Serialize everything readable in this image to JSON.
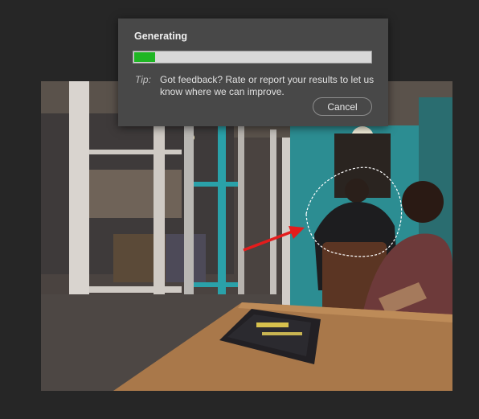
{
  "dialog": {
    "title": "Generating",
    "progress_fraction": 0.09,
    "progress_color": "#1fb624",
    "tip_label": "Tip:",
    "tip_text": "Got feedback? Rate or report your results to let us know where we can improve.",
    "cancel_label": "Cancel"
  },
  "canvas": {
    "background_color": "#262626",
    "selection": "dashed-lasso",
    "annotation": "red-arrow"
  }
}
